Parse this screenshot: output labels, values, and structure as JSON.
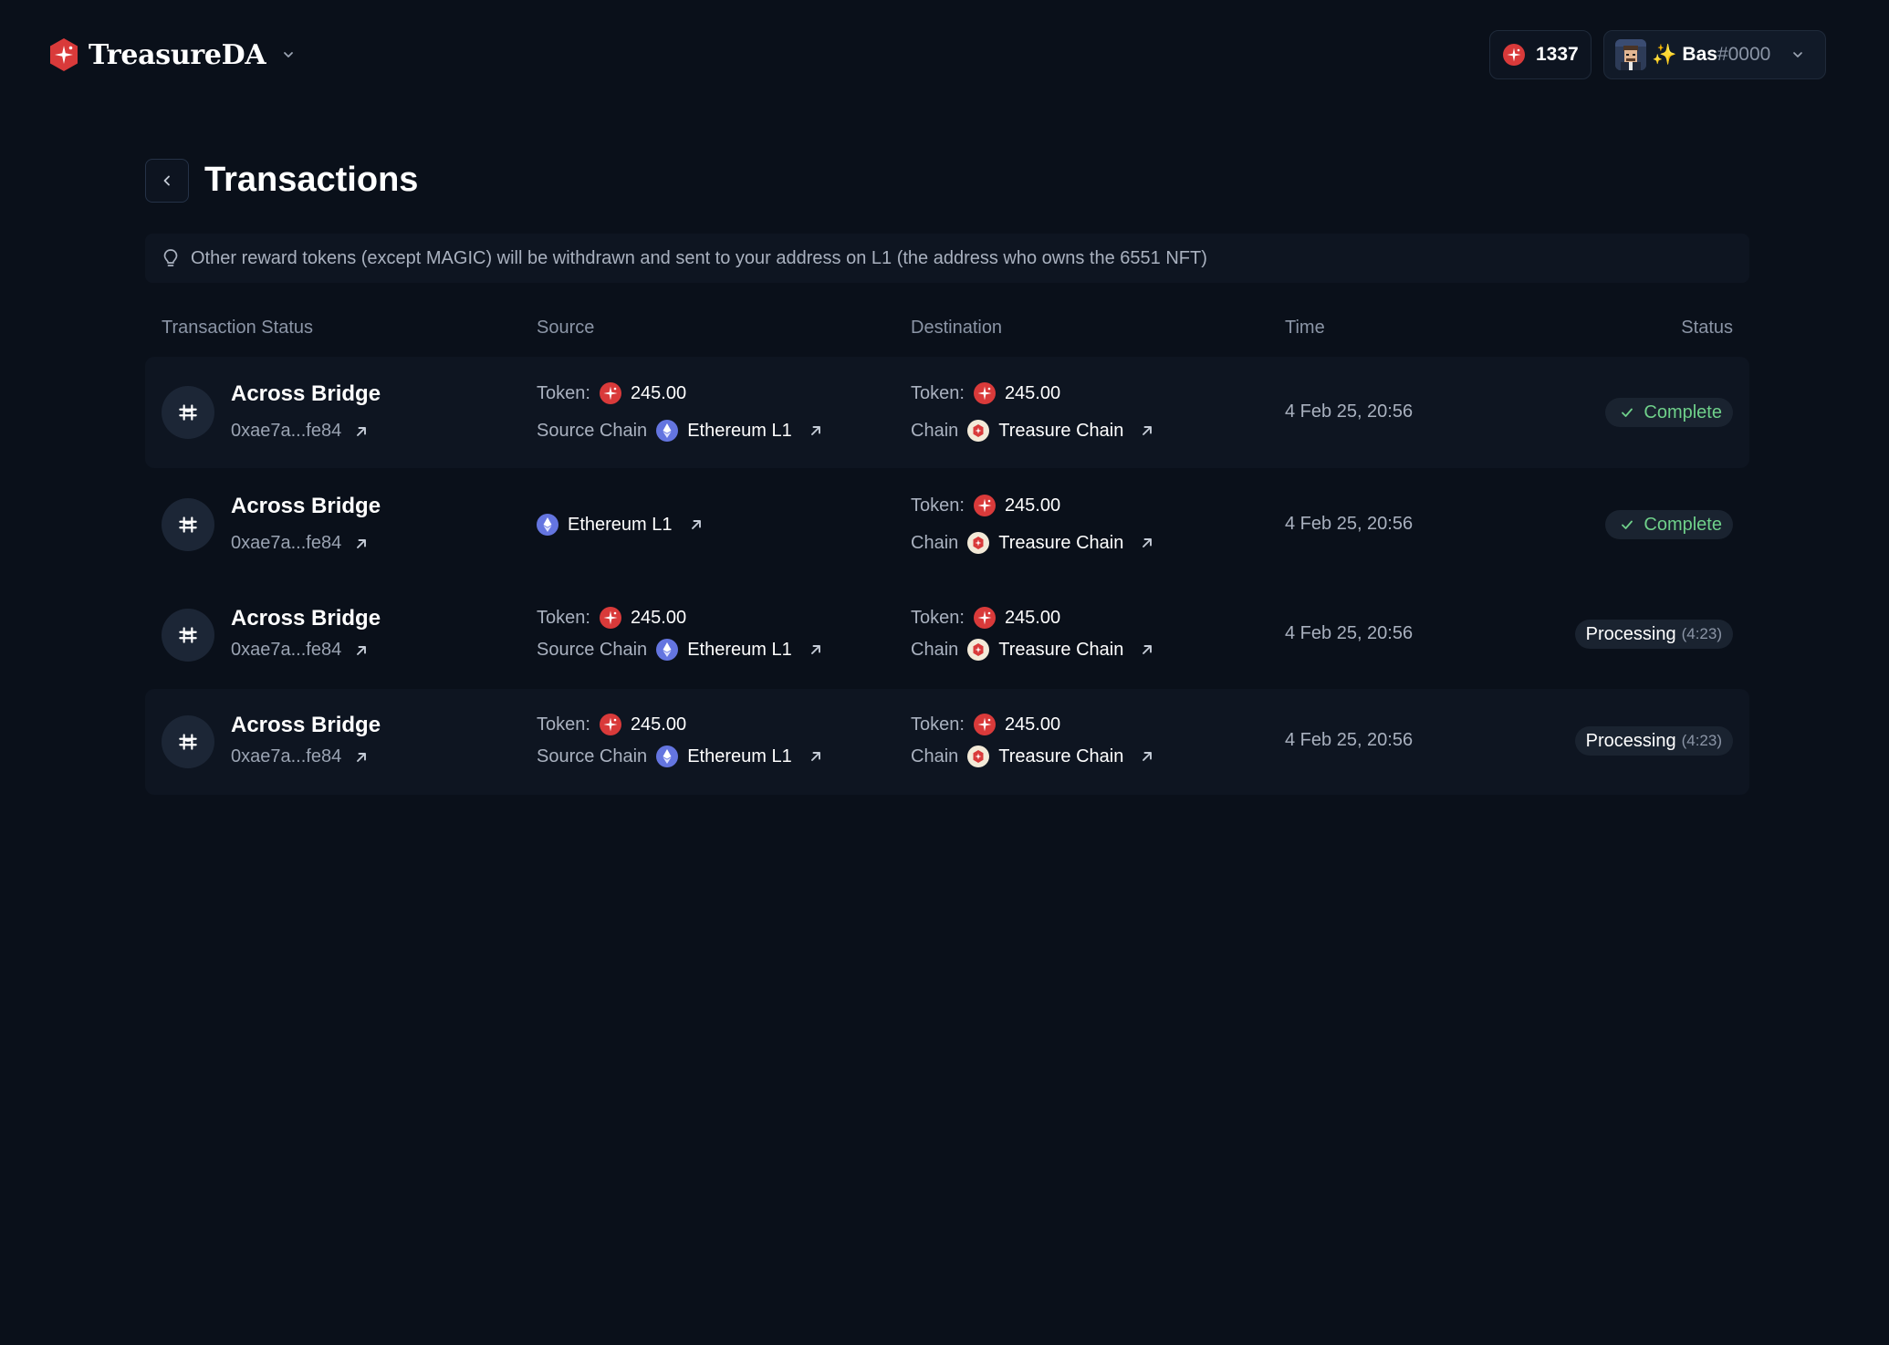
{
  "header": {
    "brand": "TreasureDA",
    "balance": "1337",
    "user": {
      "emoji": "✨",
      "name": "Bas",
      "tag": "#0000"
    }
  },
  "page": {
    "title": "Transactions",
    "notice": "Other reward tokens (except MAGIC) will be withdrawn and sent to your address on L1 (the address who owns the 6551 NFT)"
  },
  "table": {
    "columns": [
      "Transaction Status",
      "Source",
      "Destination",
      "Time",
      "Status"
    ],
    "rows": [
      {
        "name": "Across Bridge",
        "hash": "0xae7a...fe84",
        "source": {
          "token_label": "Token:",
          "token_amount": "245.00",
          "chain_label": "Source Chain",
          "chain": "Ethereum L1"
        },
        "destination": {
          "token_label": "Token:",
          "token_amount": "245.00",
          "chain_label": "Chain",
          "chain": "Treasure Chain"
        },
        "time": "4 Feb 25, 20:56",
        "status": "Complete",
        "status_sub": ""
      },
      {
        "name": "Across Bridge",
        "hash": "0xae7a...fe84",
        "source": {
          "chain": "Ethereum L1"
        },
        "destination": {
          "token_label": "Token:",
          "token_amount": "245.00",
          "chain_label": "Chain",
          "chain": "Treasure Chain"
        },
        "time": "4 Feb 25, 20:56",
        "status": "Complete",
        "status_sub": ""
      },
      {
        "name": "Across Bridge",
        "hash": "0xae7a...fe84",
        "source": {
          "token_label": "Token:",
          "token_amount": "245.00",
          "chain_label": "Source Chain",
          "chain": "Ethereum L1"
        },
        "destination": {
          "token_label": "Token:",
          "token_amount": "245.00",
          "chain_label": "Chain",
          "chain": "Treasure Chain"
        },
        "time": "4 Feb 25, 20:56",
        "status": "Processing",
        "status_sub": "(4:23)"
      },
      {
        "name": "Across Bridge",
        "hash": "0xae7a...fe84",
        "source": {
          "token_label": "Token:",
          "token_amount": "245.00",
          "chain_label": "Source Chain",
          "chain": "Ethereum L1"
        },
        "destination": {
          "token_label": "Token:",
          "token_amount": "245.00",
          "chain_label": "Chain",
          "chain": "Treasure Chain"
        },
        "time": "4 Feb 25, 20:56",
        "status": "Processing",
        "status_sub": "(4:23)"
      }
    ]
  },
  "colors": {
    "background": "#0a101a",
    "magic_red": "#d93a3a",
    "ethereum": "#6475e0",
    "complete_green": "#6fd08a"
  },
  "icons": [
    "treasure-logo-icon",
    "chevron-down-icon",
    "magic-token-icon",
    "back-chevron-icon",
    "lightbulb-icon",
    "bridge-icon",
    "external-link-icon",
    "ethereum-icon",
    "treasure-chain-icon",
    "check-icon"
  ]
}
